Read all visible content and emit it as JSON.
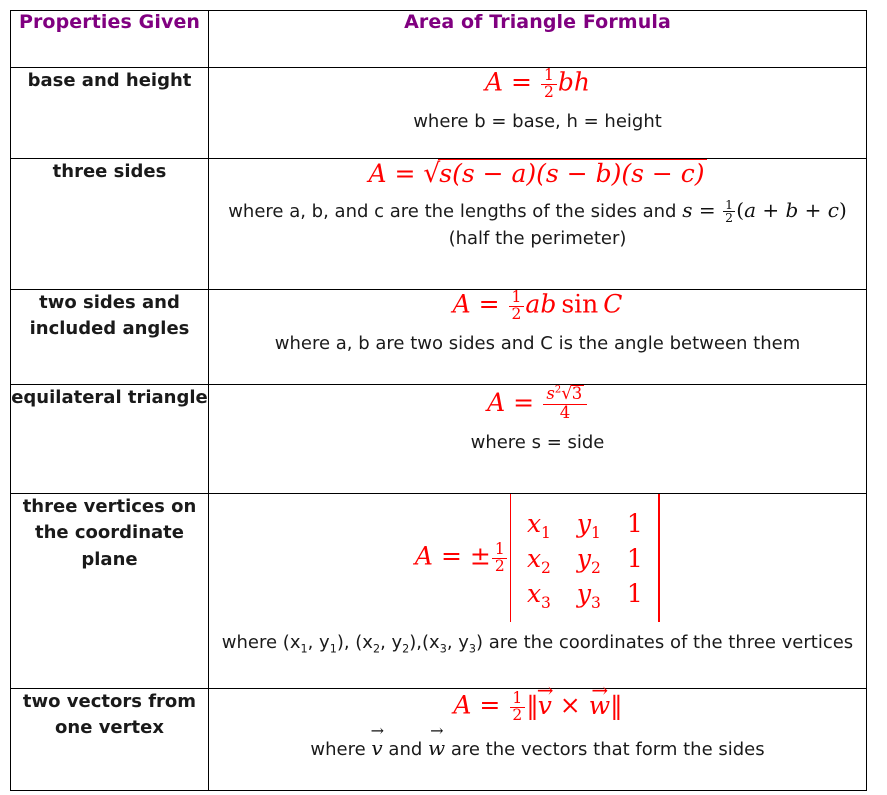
{
  "table": {
    "headers": {
      "properties": "Properties Given",
      "formula": "Area of Triangle Formula"
    },
    "header_color": "#800080",
    "formula_color": "#ff0000",
    "rows": [
      {
        "property": "base and height",
        "formula_plain": "A = 1/2 bh",
        "note": "where b = base, h = height"
      },
      {
        "property": "three sides",
        "formula_plain": "A = sqrt(s(s - a)(s - b)(s - c))",
        "note_prefix": "where a, b, and c are the lengths of the sides and",
        "note_inline_formula": "s = 1/2 (a + b + c)",
        "note_suffix": "(half the perimeter)"
      },
      {
        "property_line1": "two sides and",
        "property_line2": "included angles",
        "formula_plain": "A = 1/2 ab sin C",
        "note": "where a, b are two sides and C is the angle between them"
      },
      {
        "property": "equilateral triangle",
        "formula_plain": "A = s^2 sqrt(3) / 4",
        "note": "where s = side"
      },
      {
        "property_line1": "three vertices on",
        "property_line2": "the coordinate",
        "property_line3": "plane",
        "formula_plain": "A = ±1/2 |x1 y1 1; x2 y2 1; x3 y3 1|",
        "matrix": [
          [
            "x",
            "1",
            "y",
            "1",
            "1"
          ],
          [
            "x",
            "2",
            "y",
            "2",
            "1"
          ],
          [
            "x",
            "3",
            "y",
            "3",
            "1"
          ]
        ],
        "note": "where (x1, y1), (x2, y2),(x3, y3) are the coordinates of the three vertices"
      },
      {
        "property_line1": "two vectors from",
        "property_line2": "one vertex",
        "formula_plain": "A = 1/2 ||v × w||",
        "note": "where v and w are the vectors that form the sides"
      }
    ]
  }
}
